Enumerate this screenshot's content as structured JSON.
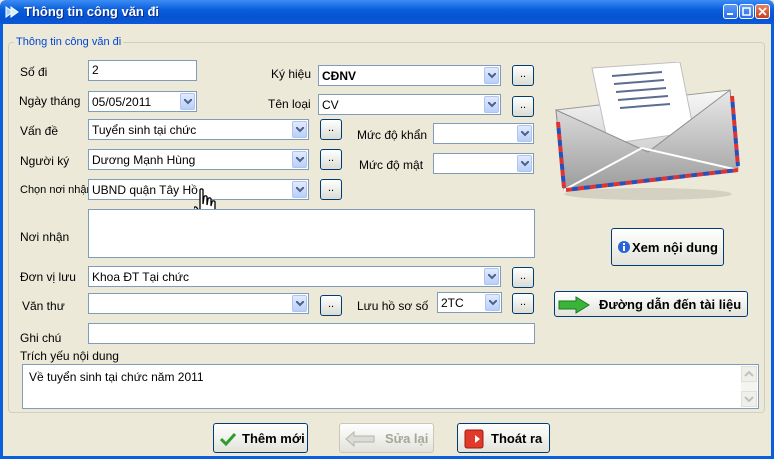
{
  "window": {
    "title": "Thông tin công văn đi"
  },
  "group": {
    "title": "Thông tin công văn đi"
  },
  "form": {
    "so_di": {
      "label": "Số đi",
      "value": "2"
    },
    "ky_hieu": {
      "label": "Ký hiệu",
      "value": "CĐNV"
    },
    "ngay_thang": {
      "label": "Ngày tháng",
      "value": "05/05/2011"
    },
    "ten_loai": {
      "label": "Tên loại",
      "value": "CV"
    },
    "van_de": {
      "label": "Vấn đề",
      "value": "Tuyển sinh tại chức"
    },
    "muc_do_khan": {
      "label": "Mức độ khẩn",
      "value": ""
    },
    "nguoi_ky": {
      "label": "Người ký",
      "value": "Dương Mạnh Hùng"
    },
    "muc_do_mat": {
      "label": "Mức độ mật",
      "value": ""
    },
    "chon_noi_nhan": {
      "label": "Chọn nơi nhận",
      "value": "UBND quận Tây Hồ"
    },
    "noi_nhan": {
      "label": "Nơi nhận",
      "value": ""
    },
    "don_vi_luu": {
      "label": "Đơn vị lưu",
      "value": "Khoa ĐT Tại chức"
    },
    "van_thu": {
      "label": "Văn thư",
      "value": ""
    },
    "luu_ho_so_so": {
      "label": "Lưu hồ sơ số",
      "value": "2TC"
    },
    "ghi_chu": {
      "label": "Ghi chú",
      "value": ""
    },
    "trich_yeu": {
      "label": "Trích yếu nội dung",
      "value": "Về tuyển sinh tại chức năm 2011"
    },
    "browse_label": ".."
  },
  "side": {
    "view_button": "Xem nội dung",
    "path_button": "Đường dẫn đến tài liệu"
  },
  "footer": {
    "add_button": "Thêm mới",
    "edit_button": "Sửa lại",
    "exit_button": "Thoát ra"
  }
}
